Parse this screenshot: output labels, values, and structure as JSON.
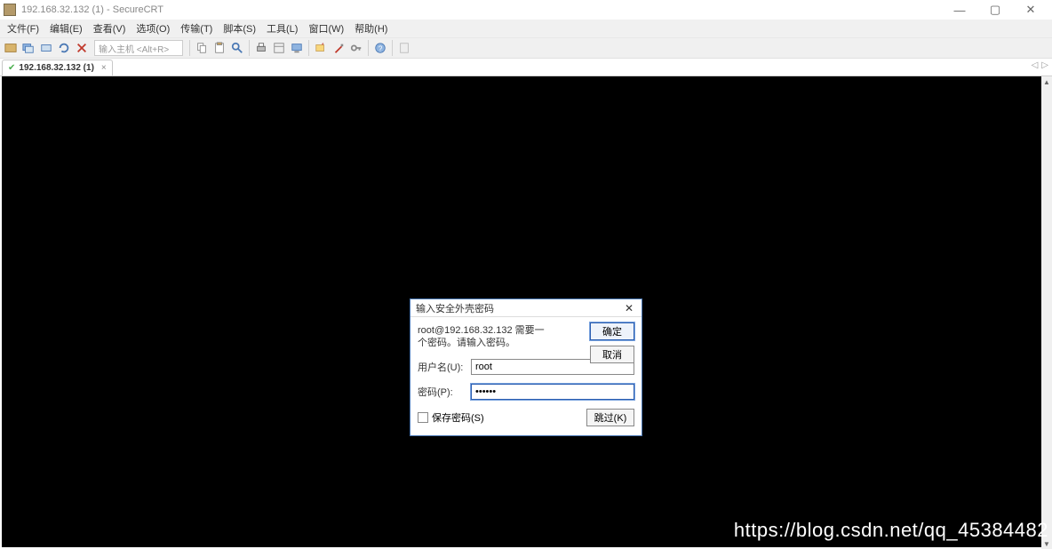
{
  "window": {
    "title": "192.168.32.132 (1) - SecureCRT",
    "min": "—",
    "max": "▢",
    "close": "✕"
  },
  "menu": {
    "file": "文件(F)",
    "edit": "编辑(E)",
    "view": "查看(V)",
    "options": "选项(O)",
    "transfer": "传输(T)",
    "script": "脚本(S)",
    "tools": "工具(L)",
    "window": "窗口(W)",
    "help": "帮助(H)"
  },
  "toolbar": {
    "host_placeholder": "输入主机 <Alt+R>"
  },
  "tab": {
    "label": "192.168.32.132 (1)",
    "close": "×",
    "nav_prev": "◁",
    "nav_next": "▷"
  },
  "dialog": {
    "title": "输入安全外壳密码",
    "close": "✕",
    "prompt": "root@192.168.32.132 需要一个密码。请输入密码。",
    "username_label": "用户名(U):",
    "username_value": "root",
    "password_label": "密码(P):",
    "password_value": "••••••",
    "save_pw_label": "保存密码(S)",
    "ok": "确定",
    "cancel": "取消",
    "skip": "跳过(K)"
  },
  "watermark": "https://blog.csdn.net/qq_45384482"
}
